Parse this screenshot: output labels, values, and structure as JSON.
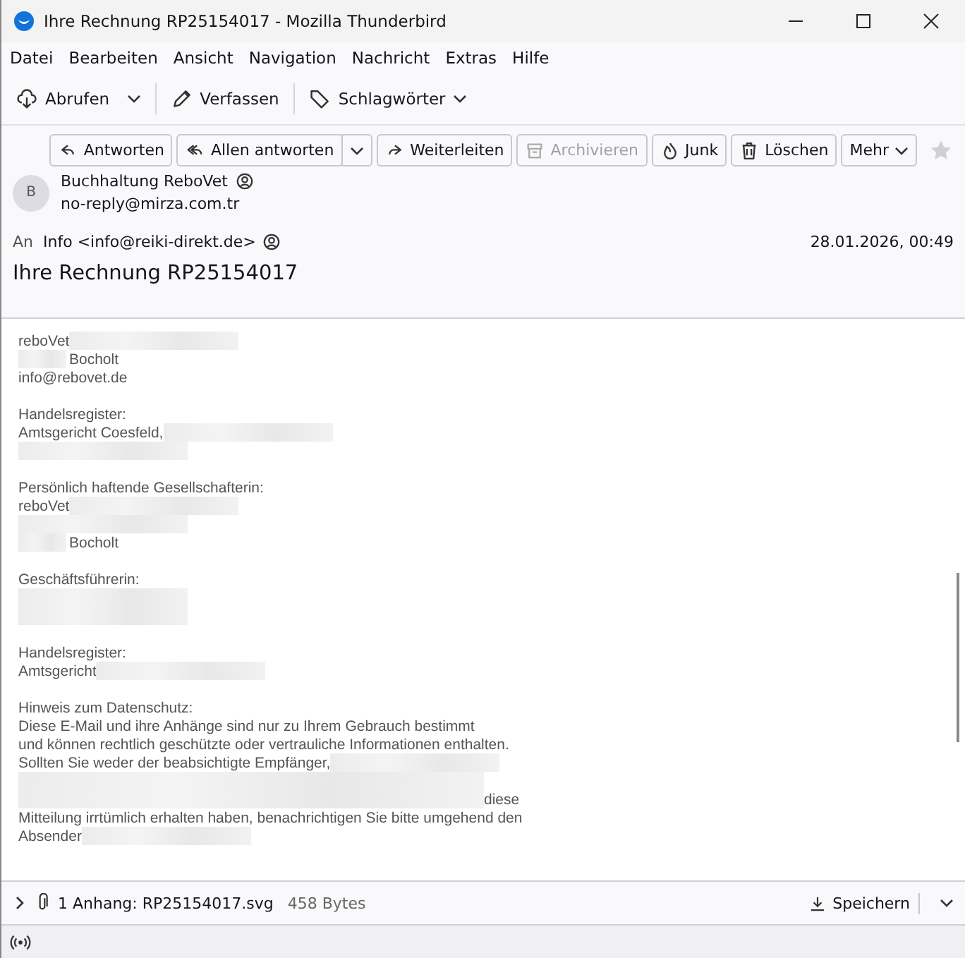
{
  "window": {
    "title": "Ihre Rechnung RP25154017 - Mozilla Thunderbird"
  },
  "menu": [
    "Datei",
    "Bearbeiten",
    "Ansicht",
    "Navigation",
    "Nachricht",
    "Extras",
    "Hilfe"
  ],
  "toolbar": [
    {
      "label": "Abrufen",
      "kind": "get"
    },
    {
      "label": "Verfassen",
      "kind": "write"
    },
    {
      "label": "Schlagwörter",
      "kind": "tag"
    }
  ],
  "actions": [
    {
      "label": "Antworten",
      "kind": "reply",
      "disabled": false
    },
    {
      "label": "Allen antworten",
      "kind": "replyall",
      "disabled": false
    },
    {
      "label": "Weiterleiten",
      "kind": "forward",
      "disabled": false
    },
    {
      "label": "Archivieren",
      "kind": "archive",
      "disabled": true
    },
    {
      "label": "Junk",
      "kind": "junk",
      "disabled": false
    },
    {
      "label": "Löschen",
      "kind": "delete",
      "disabled": false
    },
    {
      "label": "Mehr",
      "kind": "more",
      "disabled": false
    }
  ],
  "message": {
    "starred": false,
    "avatar": "B",
    "sender_name": "Buchhaltung ReboVet",
    "sender_email": "no-reply@mirza.com.tr",
    "to_label": "An",
    "to": "Info <info@reiki-direkt.de>",
    "date": "28.01.2026, 00:49",
    "subject": "Ihre Rechnung RP25154017"
  },
  "body": [
    {
      "kind": "tailblur",
      "text": "reboVet"
    },
    {
      "kind": "headblur",
      "text": "Bocholt"
    },
    {
      "kind": "plain",
      "text": "info@rebovet.de"
    },
    {
      "kind": "gap"
    },
    {
      "kind": "plain",
      "text": "Handelsregister:"
    },
    {
      "kind": "tailblur",
      "text": "Amtsgericht Coesfeld,"
    },
    {
      "kind": "blurred"
    },
    {
      "kind": "gap"
    },
    {
      "kind": "plain",
      "text": "Persönlich haftende Gesellschafterin:"
    },
    {
      "kind": "tailblur",
      "text": "reboVet"
    },
    {
      "kind": "blurred"
    },
    {
      "kind": "headblur",
      "text": "Bocholt"
    },
    {
      "kind": "gap"
    },
    {
      "kind": "plain",
      "text": "Geschäftsführerin:"
    },
    {
      "kind": "blurred"
    },
    {
      "kind": "blurred"
    },
    {
      "kind": "gap"
    },
    {
      "kind": "plain",
      "text": "Handelsregister:"
    },
    {
      "kind": "tailblur",
      "text": "Amtsgericht"
    },
    {
      "kind": "gap"
    },
    {
      "kind": "plain",
      "text": "Hinweis zum Datenschutz:"
    },
    {
      "kind": "plain",
      "text": "Diese E-Mail und ihre Anhänge sind nur zu Ihrem Gebrauch bestimmt"
    },
    {
      "kind": "plain",
      "text": "und können rechtlich geschützte oder vertrauliche Informationen enthalten."
    },
    {
      "kind": "tailblur",
      "text": "Sollten Sie weder der beabsichtigte Empfänger,"
    },
    {
      "kind": "wideblur"
    },
    {
      "kind": "wideheadblur",
      "text": "diese"
    },
    {
      "kind": "plain",
      "text": "Mitteilung irrtümlich erhalten haben, benachrichtigen Sie bitte umgehend den"
    },
    {
      "kind": "tailblur",
      "text": "Absender"
    }
  ],
  "attachment": {
    "label": "1 Anhang: RP25154017.svg",
    "size": "458 Bytes",
    "save": "Speichern"
  }
}
